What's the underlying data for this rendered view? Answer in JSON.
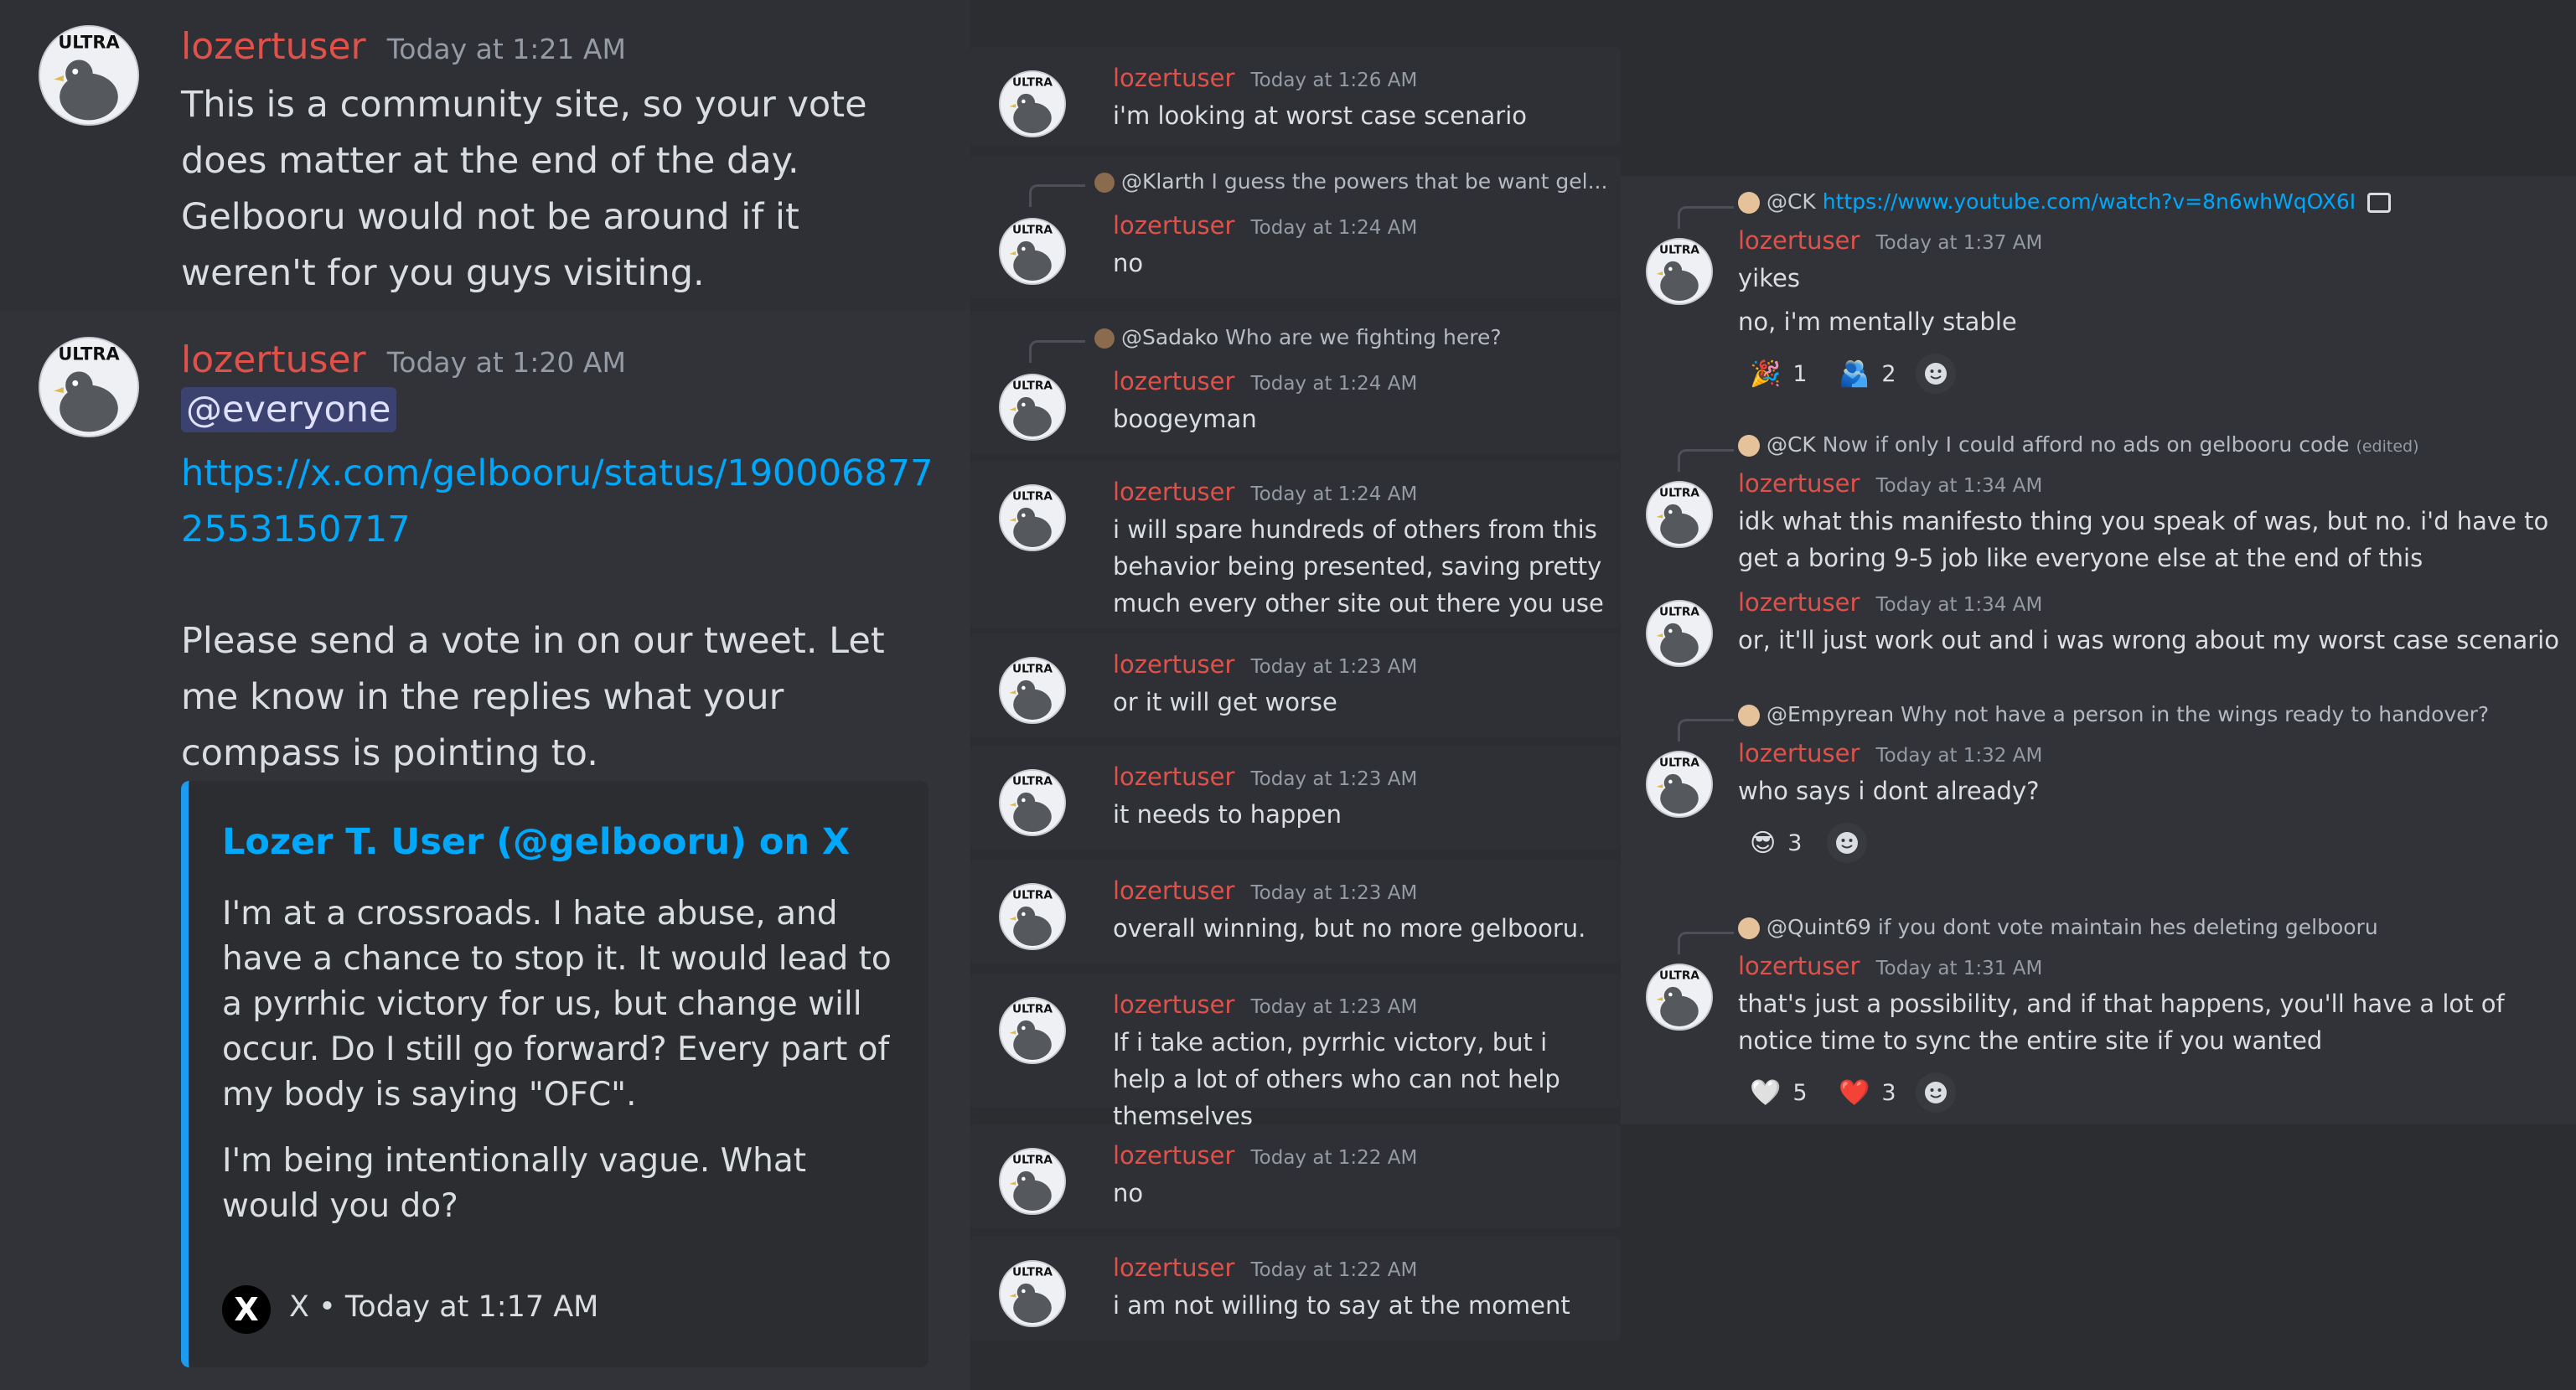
{
  "accent_colors": {
    "username": "#e0514a",
    "link": "#00a8fc",
    "embed_bar": "#1d9bf0",
    "mention_bg": "#3c4270"
  },
  "left": {
    "msg1": {
      "author": "lozertuser",
      "time": "Today at 1:21 AM",
      "text": "This is a community site, so your vote does matter at the end of the day. Gelbooru would not be around if it weren't for you guys visiting."
    },
    "msg2": {
      "author": "lozertuser",
      "time": "Today at 1:20 AM",
      "mention": "@everyone",
      "link": "https://x.com/gelbooru/status/1900068772553150717",
      "text": "Please send a vote in on our tweet. Let me know in the replies what your compass  is pointing to.",
      "embed": {
        "title": "Lozer T. User (@gelbooru) on X",
        "body1": "I'm at a crossroads. I hate abuse, and have a chance to stop it. It would lead to a pyrrhic victory for us, but change will occur. Do I still go forward? Every part of my body is saying \"OFC\".",
        "body2": "I'm being intentionally vague. What would you do?",
        "footer": "X • Today at 1:17 AM",
        "icon": "x-logo-icon"
      }
    }
  },
  "middle": {
    "messages": [
      {
        "author": "lozertuser",
        "time": "Today at 1:26 AM",
        "text": "i'm looking at worst case scenario"
      },
      {
        "reply_name": "@Klarth",
        "reply_text": "I guess the powers that be want gel...",
        "author": "lozertuser",
        "time": "Today at 1:24 AM",
        "text": "no"
      },
      {
        "reply_name": "@Sadako",
        "reply_text": "Who are we fighting here?",
        "author": "lozertuser",
        "time": "Today at 1:24 AM",
        "text": "boogeyman"
      },
      {
        "author": "lozertuser",
        "time": "Today at 1:24 AM",
        "text": "i will spare hundreds of others from this behavior being presented, saving pretty much every other site out there you use"
      },
      {
        "author": "lozertuser",
        "time": "Today at 1:23 AM",
        "text": "or it will get worse"
      },
      {
        "author": "lozertuser",
        "time": "Today at 1:23 AM",
        "text": "it needs to happen"
      },
      {
        "author": "lozertuser",
        "time": "Today at 1:23 AM",
        "text": "overall winning, but no more gelbooru."
      },
      {
        "author": "lozertuser",
        "time": "Today at 1:23 AM",
        "text": "If i take action, pyrrhic victory, but i help a lot of others who can not help themselves"
      },
      {
        "author": "lozertuser",
        "time": "Today at 1:22 AM",
        "text": "no"
      },
      {
        "author": "lozertuser",
        "time": "Today at 1:22 AM",
        "text": "i am not willing to say at the moment"
      }
    ]
  },
  "right": {
    "messages": [
      {
        "reply_name": "@CK",
        "reply_text": "https://www.youtube.com/watch?v=8n6whWqOX6I",
        "author": "lozertuser",
        "time": "Today at 1:37 AM",
        "text": "yikes",
        "text2": "no, i'm mentally stable",
        "reactions": [
          {
            "emoji": "🎉",
            "count": "1"
          },
          {
            "emoji": "🫂",
            "count": "2"
          }
        ]
      },
      {
        "reply_name": "@CK",
        "reply_text": "Now if only I could afford no ads on gelbooru code",
        "reply_edited": "(edited)",
        "author": "lozertuser",
        "time": "Today at 1:34 AM",
        "text": "idk what this manifesto thing you speak of was, but no. i'd have to get a boring 9-5 job like everyone else at the end of this"
      },
      {
        "author": "lozertuser",
        "time": "Today at 1:34 AM",
        "text": "or, it'll just work out and i was wrong about my worst case scenario"
      },
      {
        "reply_name": "@Empyrean",
        "reply_text": "Why not have a person in the wings ready to handover?",
        "author": "lozertuser",
        "time": "Today at 1:32 AM",
        "text": "who says i dont already?",
        "reactions": [
          {
            "emoji": "😎",
            "count": "3"
          }
        ]
      },
      {
        "reply_name": "@Quint69",
        "reply_text": "if you dont vote maintain hes deleting gelbooru",
        "author": "lozertuser",
        "time": "Today at 1:31 AM",
        "text": "that's just a possibility, and if that happens, you'll have a lot of notice time to sync the entire site if you wanted",
        "reactions": [
          {
            "emoji": "🤍",
            "count": "5"
          },
          {
            "emoji": "❤️",
            "count": "3"
          }
        ]
      }
    ]
  }
}
